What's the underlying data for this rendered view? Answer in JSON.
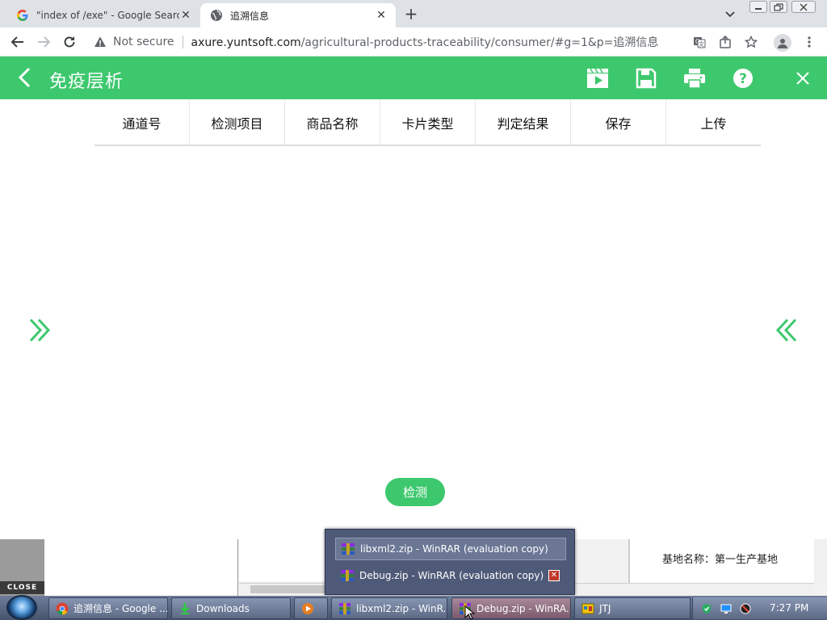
{
  "browser": {
    "tabs": [
      {
        "title": "\"index of /exe\" - Google Search",
        "icon": "google-icon"
      },
      {
        "title": "追溯信息",
        "icon": "globe-icon",
        "active": true
      }
    ],
    "security_label": "Not secure",
    "url_host": "axure.yuntsoft.com",
    "url_path": "/agricultural-products-traceability/consumer/#g=1&p=追溯信息"
  },
  "app": {
    "title": "免疫层析",
    "accent_color": "#3ec86e",
    "header_icons": [
      "play-icon",
      "save-icon",
      "print-icon",
      "help-icon",
      "close-icon"
    ],
    "table_headers": [
      "通道号",
      "检测项目",
      "商品名称",
      "卡片类型",
      "判定结果",
      "保存",
      "上传"
    ],
    "detect_button": "检测"
  },
  "background_window": {
    "close_label": "CLOSE",
    "info_text": "基地名称：第一生产基地"
  },
  "taskbar_popup": {
    "items": [
      "libxml2.zip - WinRAR (evaluation copy)",
      "Debug.zip - WinRAR (evaluation copy)"
    ]
  },
  "taskbar": {
    "buttons": [
      {
        "label": "追溯信息 - Google ...",
        "icon": "chrome-icon"
      },
      {
        "label": "Downloads",
        "icon": "download-icon"
      },
      {
        "label": "",
        "icon": "media-player-icon"
      },
      {
        "label": "libxml2.zip - WinR...",
        "icon": "winrar-icon"
      },
      {
        "label": "Debug.zip - WinRA...",
        "icon": "winrar-icon",
        "active": true
      },
      {
        "label": "JTJ",
        "icon": "app-icon"
      }
    ],
    "clock": "7:27 PM"
  }
}
